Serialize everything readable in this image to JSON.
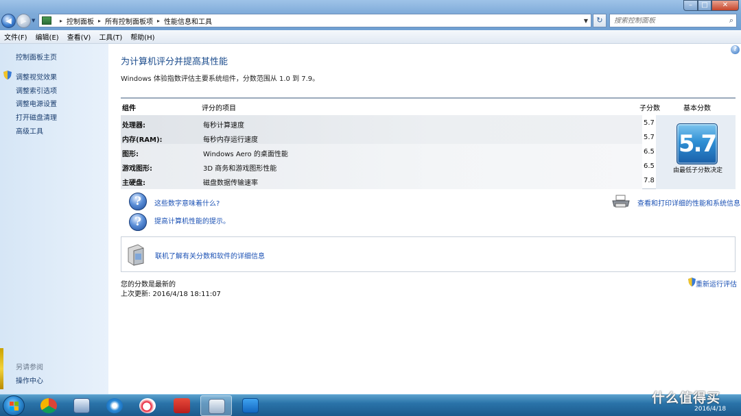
{
  "window": {
    "breadcrumbs": [
      "控制面板",
      "所有控制面板项",
      "性能信息和工具"
    ],
    "search_placeholder": "搜索控制面板",
    "controls": {
      "minimize": "–",
      "maximize": "□",
      "close": "✕"
    }
  },
  "menu": [
    "文件(F)",
    "编辑(E)",
    "查看(V)",
    "工具(T)",
    "帮助(H)"
  ],
  "sidebar": {
    "home": "控制面板主页",
    "links": [
      "调整视觉效果",
      "调整索引选项",
      "调整电源设置",
      "打开磁盘清理",
      "高级工具"
    ],
    "see_also_heading": "另请参阅",
    "see_also_links": [
      "操作中心"
    ]
  },
  "main": {
    "title": "为计算机评分并提高其性能",
    "intro": "Windows 体验指数评估主要系统组件，分数范围从 1.0 到 7.9。",
    "table": {
      "headers": {
        "component": "组件",
        "item": "评分的项目",
        "subscore": "子分数",
        "base": "基本分数"
      },
      "rows": [
        {
          "component": "处理器:",
          "item": "每秒计算速度",
          "score": "5.7"
        },
        {
          "component": "内存(RAM):",
          "item": "每秒内存运行速度",
          "score": "5.7"
        },
        {
          "component": "图形:",
          "item": "Windows Aero 的桌面性能",
          "score": "6.5"
        },
        {
          "component": "游戏图形:",
          "item": "3D 商务和游戏图形性能",
          "score": "6.5"
        },
        {
          "component": "主硬盘:",
          "item": "磁盘数据传输速率",
          "score": "7.8"
        }
      ],
      "base_score": "5.7",
      "base_caption": "由最低子分数决定"
    },
    "links": {
      "what_mean": "这些数字意味着什么?",
      "tips": "提高计算机性能的提示。",
      "print": "查看和打印详细的性能和系统信息",
      "online": "联机了解有关分数和软件的详细信息"
    },
    "status": {
      "current": "您的分数是最新的",
      "last_update": "上次更新: 2016/4/18 18:11:07",
      "rerun": "重新运行评估"
    }
  },
  "taskbar": {
    "clock_date": "2016/4/18",
    "watermark": "什么值得买"
  },
  "colors": {
    "accent": "#1a4b8c",
    "link": "#1b51b4",
    "taskbar": "#2a73a9",
    "score_tile": "#2f8fd4"
  }
}
